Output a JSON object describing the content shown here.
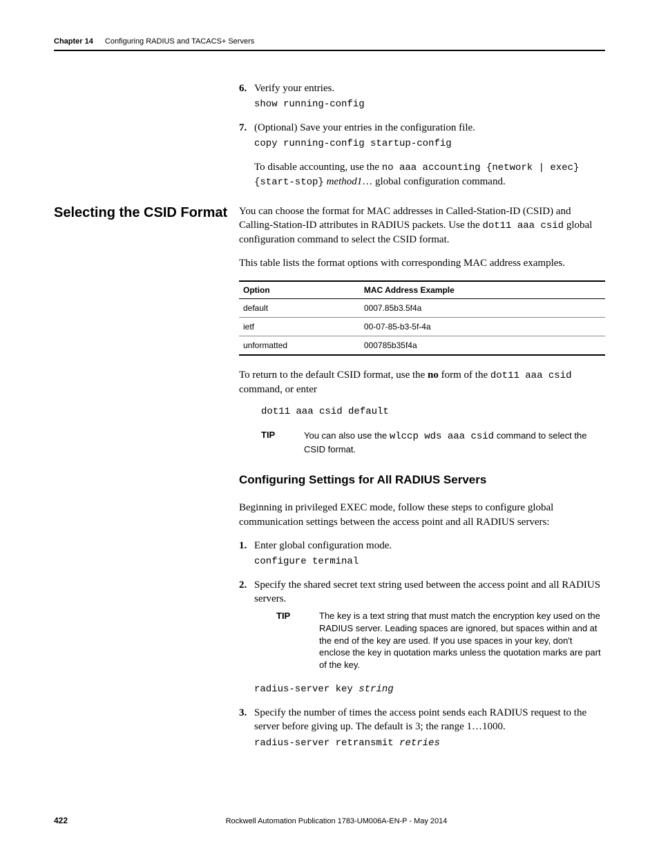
{
  "header": {
    "chapter_label": "Chapter 14",
    "chapter_title": "Configuring RADIUS and TACACS+ Servers"
  },
  "top_steps": [
    {
      "num": "6.",
      "text": "Verify your entries.",
      "code": "show running-config"
    },
    {
      "num": "7.",
      "text": "(Optional) Save your entries in the configuration file.",
      "code": "copy running-config startup-config",
      "after_pre": "To disable accounting, use the ",
      "after_code1": "no aaa accounting {network | exec} {start-stop}",
      "after_italic": " method1",
      "after_post": "… global configuration command."
    }
  ],
  "section1": {
    "heading": "Selecting the CSID Format",
    "p1_pre": "You can choose the format for MAC addresses in Called-Station-ID (CSID) and Calling-Station-ID attributes in RADIUS packets. Use the ",
    "p1_code": "dot11 aaa csid",
    "p1_post": " global configuration command to select the CSID format.",
    "p2": "This table lists the format options with corresponding MAC address examples.",
    "table": {
      "headers": [
        "Option",
        "MAC Address Example"
      ],
      "rows": [
        [
          "default",
          "0007.85b3.5f4a"
        ],
        [
          "ietf",
          "00-07-85-b3-5f-4a"
        ],
        [
          "unformatted",
          "000785b35f4a"
        ]
      ]
    },
    "p3_pre": "To return to the default CSID format, use the ",
    "p3_bold": "no",
    "p3_mid": " form of the ",
    "p3_code": "dot11 aaa csid",
    "p3_post": " command, or enter",
    "code_line": "dot11 aaa csid default",
    "tip": {
      "label": "TIP",
      "pre": "You can also use the ",
      "code": "wlccp wds aaa csid",
      "post": " command to select the CSID format."
    }
  },
  "section2": {
    "heading": "Configuring Settings for All RADIUS Servers",
    "intro": "Beginning in privileged EXEC mode, follow these steps to configure global communication settings between the access point and all RADIUS servers:",
    "steps": [
      {
        "num": "1.",
        "text": "Enter global configuration mode.",
        "code": "configure terminal"
      },
      {
        "num": "2.",
        "text": "Specify the shared secret text string used between the access point and all RADIUS servers.",
        "tip": {
          "label": "TIP",
          "text": "The key is a text string that must match the encryption key used on the RADIUS server. Leading spaces are ignored, but spaces within and at the end of the key are used. If you use spaces in your key, don't enclose the key in quotation marks unless the quotation marks are part of the key."
        },
        "code_pre": "radius-server key ",
        "code_italic": "string"
      },
      {
        "num": "3.",
        "text": "Specify the number of times the access point sends each RADIUS request to the server before giving up. The default is 3; the range 1…1000.",
        "code_pre": "radius-server retransmit ",
        "code_italic": "retries"
      }
    ]
  },
  "footer": {
    "page": "422",
    "pub": "Rockwell Automation Publication 1783-UM006A-EN-P - May 2014"
  }
}
